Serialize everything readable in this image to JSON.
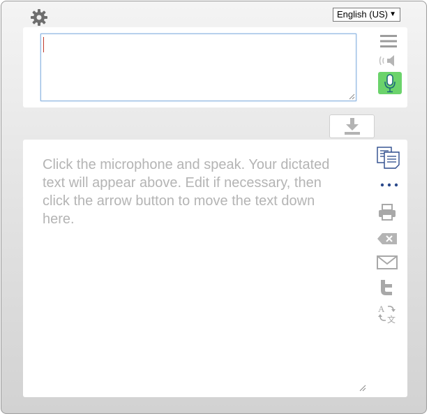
{
  "language_select": {
    "selected": "English (US)"
  },
  "dictation": {
    "value": ""
  },
  "output": {
    "placeholder": "Click the microphone and speak. Your dictated text will appear above. Edit if necessary, then click the arrow button to move the text down here."
  },
  "colors": {
    "mic_active": "#6bd36b",
    "icon_gray": "#9c9c9c",
    "copy_blue": "#2b4a8b",
    "placeholder_text": "#b4b4b4"
  },
  "icons": {
    "settings": "gear-icon",
    "menu": "hamburger-icon",
    "speaker": "speaker-icon",
    "microphone": "microphone-icon",
    "transfer": "download-arrow-icon",
    "copy": "copy-icon",
    "more": "ellipsis-icon",
    "print": "printer-icon",
    "clear": "backspace-icon",
    "email": "envelope-icon",
    "twitter": "twitter-icon",
    "translate": "translate-icon"
  }
}
